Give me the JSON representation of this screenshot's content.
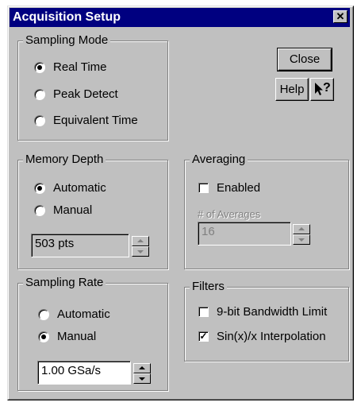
{
  "window": {
    "title": "Acquisition Setup",
    "close_glyph": "✕"
  },
  "buttons": {
    "close": "Close",
    "help": "Help",
    "help_glyph": "?"
  },
  "sampling_mode": {
    "label": "Sampling Mode",
    "options": [
      {
        "label": "Real Time",
        "selected": true
      },
      {
        "label": "Peak Detect",
        "selected": false
      },
      {
        "label": "Equivalent Time",
        "selected": false
      }
    ]
  },
  "memory_depth": {
    "label": "Memory Depth",
    "options": [
      {
        "label": "Automatic",
        "selected": true
      },
      {
        "label": "Manual",
        "selected": false
      }
    ],
    "value": "503 pts"
  },
  "averaging": {
    "label": "Averaging",
    "enabled_label": "Enabled",
    "enabled": false,
    "count_label": "# of Averages",
    "count_value": "16"
  },
  "sampling_rate": {
    "label": "Sampling Rate",
    "options": [
      {
        "label": "Automatic",
        "selected": false
      },
      {
        "label": "Manual",
        "selected": true
      }
    ],
    "value": "1.00 GSa/s"
  },
  "filters": {
    "label": "Filters",
    "items": [
      {
        "label": "9-bit Bandwidth Limit",
        "checked": false
      },
      {
        "label": "Sin(x)/x Interpolation",
        "checked": true
      }
    ]
  }
}
